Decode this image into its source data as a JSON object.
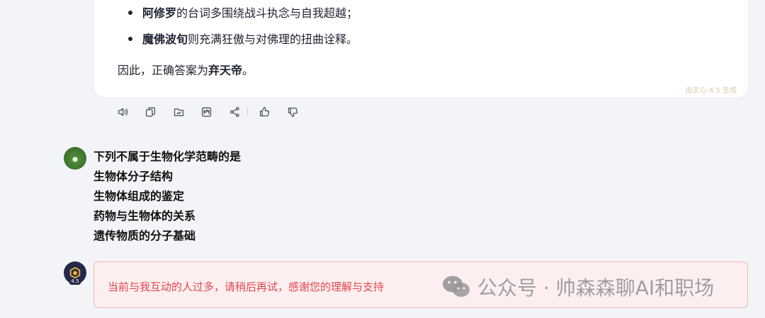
{
  "answer": {
    "bullets": [
      {
        "bold": "阿修罗",
        "rest": "的台词多围绕战斗执念与自我超越；"
      },
      {
        "bold": "魔佛波旬",
        "rest": "则充满狂傲与对佛理的扭曲诠释。"
      }
    ],
    "conclusion_prefix": "因此，正确答案为",
    "conclusion_answer": "弃天帝",
    "conclusion_suffix": "。",
    "badge": "由文心 4.5 生成"
  },
  "toolbar": {
    "icons": [
      "speaker-icon",
      "copy-icon",
      "export-icon",
      "chart-icon",
      "share-icon",
      "thumbs-up-icon",
      "thumbs-down-icon"
    ]
  },
  "user_message": {
    "lines": [
      "下列不属于生物化学范畴的是",
      "生物体分子结构",
      "生物体组成的鉴定",
      "药物与生物体的关系",
      "遗传物质的分子基础"
    ]
  },
  "bot": {
    "avatar_version": "4.5",
    "error_text": "当前与我互动的人过多，请稍后再试，感谢您的理解与支持"
  },
  "watermark": {
    "text": "公众号 · 帅森森聊AI和职场"
  },
  "colors": {
    "error_text": "#e2474f",
    "error_bg": "#fdeff0",
    "error_border": "#f2b3b8",
    "badge": "#d9c9a8"
  }
}
